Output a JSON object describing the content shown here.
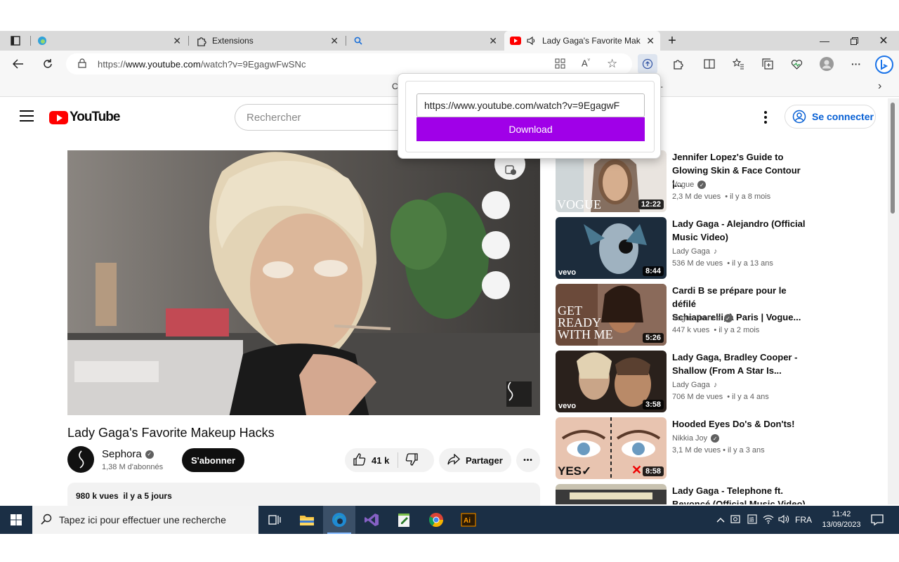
{
  "browser": {
    "tabs": [
      {
        "label": "",
        "icon": "edge-icon"
      },
      {
        "label": "Extensions",
        "icon": "extension-puzzle-icon"
      },
      {
        "label": "",
        "icon": "search-icon"
      },
      {
        "label": "Lady Gaga's Favorite Makeu",
        "icon": "youtube-icon"
      }
    ],
    "url_prefix": "https://",
    "url_domain": "www.youtube.com",
    "url_path": "/watch?v=9EgagwFwSNc",
    "favbar_fragment_left": "C",
    "favbar_fragment_right": "-"
  },
  "youtube": {
    "logo_text": "YouTube",
    "search_placeholder": "Rechercher",
    "signin_label": "Se connecter",
    "video": {
      "title": "Lady Gaga's Favorite Makeup Hacks",
      "channel": "Sephora",
      "subscribers": "1,38 M d'abonnés",
      "subscribe_label": "S'abonner",
      "likes": "41 k",
      "share_label": "Partager",
      "more_label": "•••",
      "views_date": "980 k vues  il y a 5 jours"
    },
    "recommended": [
      {
        "title_line1": "Jennifer Lopez's Guide to",
        "title_line2": "Glowing Skin & Face Contour |...",
        "channel": "Vogue",
        "badge": "verified",
        "meta": "2,3 M de vues  • il y a 8 mois",
        "duration": "12:22",
        "thumb_text": "VOGUE"
      },
      {
        "title_line1": "Lady Gaga - Alejandro (Official",
        "title_line2": "Music Video)",
        "channel": "Lady Gaga",
        "badge": "music",
        "meta": "536 M de vues  • il y a 13 ans",
        "duration": "8:44",
        "thumb_text": "vevo"
      },
      {
        "title_line1": "Cardi B se prépare pour le défilé",
        "title_line2": "Schiaparelli, à Paris | Vogue...",
        "channel": "Vogue France",
        "badge": "verified",
        "meta": "447 k vues  • il y a 2 mois",
        "duration": "5:26",
        "thumb_text": "GET READY WITH ME"
      },
      {
        "title_line1": "Lady Gaga, Bradley Cooper -",
        "title_line2": "Shallow (From A Star Is...",
        "channel": "Lady Gaga",
        "badge": "music",
        "meta": "706 M de vues  • il y a 4 ans",
        "duration": "3:58",
        "thumb_text": "vevo"
      },
      {
        "title_line1": "Hooded Eyes Do's & Don'ts!",
        "title_line2": "",
        "channel": "Nikkia Joy",
        "badge": "verified",
        "meta": "3,1 M de vues  • il y a 3 ans",
        "duration": "8:58",
        "thumb_text": "YES✓"
      },
      {
        "title_line1": "Lady Gaga - Telephone ft.",
        "title_line2": "Beyoncé (Official Music Video)",
        "channel": "",
        "badge": "",
        "meta": "",
        "duration": "",
        "thumb_text": ""
      }
    ]
  },
  "extension_popup": {
    "url_value": "https://www.youtube.com/watch?v=9EgagwF",
    "download_label": "Download",
    "button_color": "#a000e8"
  },
  "taskbar": {
    "search_placeholder": "Tapez ici pour effectuer une recherche",
    "language": "FRA",
    "time": "11:42",
    "date": "13/09/2023"
  }
}
